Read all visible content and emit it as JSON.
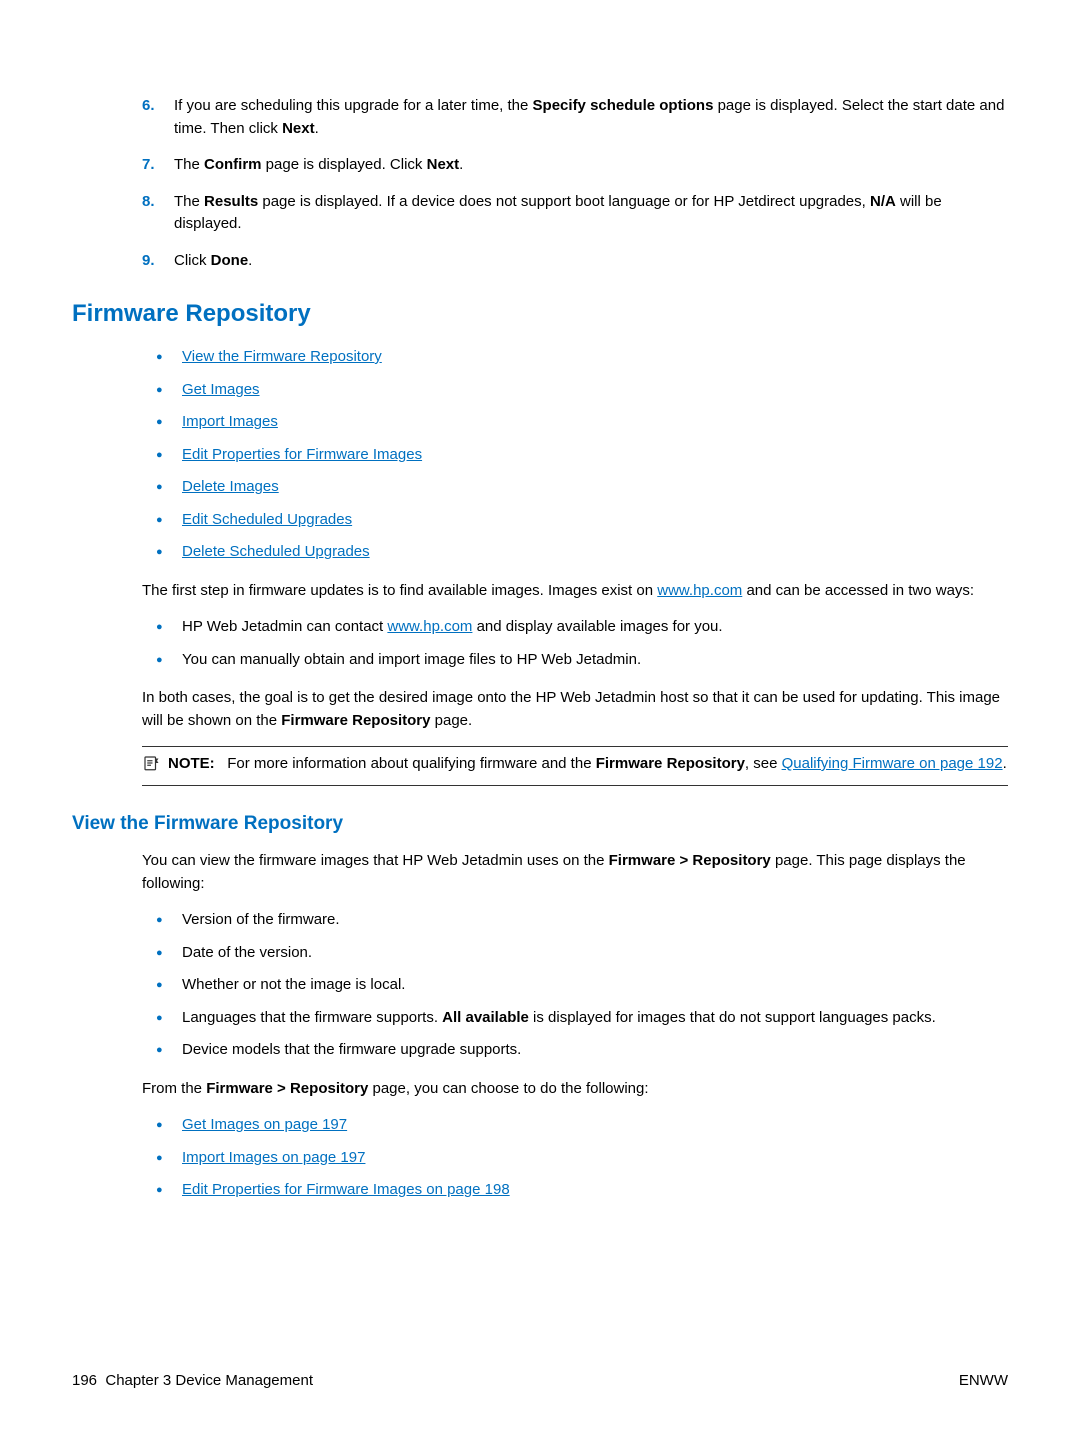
{
  "steps": [
    {
      "num": "6.",
      "pre": "If you are scheduling this upgrade for a later time, the ",
      "b1": "Specify schedule options",
      "mid": " page is displayed. Select the start date and time. Then click ",
      "b2": "Next",
      "post": "."
    },
    {
      "num": "7.",
      "pre": "The ",
      "b1": "Confirm",
      "mid": " page is displayed. Click ",
      "b2": "Next",
      "post": "."
    },
    {
      "num": "8.",
      "pre": "The ",
      "b1": "Results",
      "mid": " page is displayed. If a device does not support boot language or for HP Jetdirect upgrades, ",
      "b2": "N/A",
      "post": " will be displayed."
    },
    {
      "num": "9.",
      "pre": "Click ",
      "b1": "Done",
      "mid": "",
      "b2": "",
      "post": "."
    }
  ],
  "h1": "Firmware Repository",
  "links1": [
    "View the Firmware Repository",
    "Get Images",
    "Import Images",
    "Edit Properties for Firmware Images",
    "Delete Images",
    "Edit Scheduled Upgrades",
    "Delete Scheduled Upgrades"
  ],
  "p1": {
    "pre": "The first step in firmware updates is to find available images. Images exist on ",
    "link": "www.hp.com",
    "post": " and can be accessed in two ways:"
  },
  "ways": [
    {
      "pre": "HP Web Jetadmin can contact ",
      "link": "www.hp.com",
      "post": " and display available images for you."
    },
    {
      "pre": "You can manually obtain and import image files to HP Web Jetadmin.",
      "link": "",
      "post": ""
    }
  ],
  "p2": {
    "pre": "In both cases, the goal is to get the desired image onto the HP Web Jetadmin host so that it can be used for updating. This image will be shown on the ",
    "b": "Firmware Repository",
    "post": " page."
  },
  "note": {
    "label": "NOTE:",
    "pre": "For more information about qualifying firmware and the ",
    "b": "Firmware Repository",
    "mid": ", see ",
    "link": "Qualifying Firmware on page 192",
    "post": "."
  },
  "h2": "View the Firmware Repository",
  "p3": {
    "pre": "You can view the firmware images that HP Web Jetadmin uses on the ",
    "b": "Firmware > Repository",
    "post": " page. This page displays the following:"
  },
  "view_items": [
    {
      "pre": "Version of the firmware.",
      "b": "",
      "post": ""
    },
    {
      "pre": "Date of the version.",
      "b": "",
      "post": ""
    },
    {
      "pre": "Whether or not the image is local.",
      "b": "",
      "post": ""
    },
    {
      "pre": "Languages that the firmware supports. ",
      "b": "All available",
      "post": " is displayed for images that do not support languages packs."
    },
    {
      "pre": "Device models that the firmware upgrade supports.",
      "b": "",
      "post": ""
    }
  ],
  "p4": {
    "pre": "From the ",
    "b": "Firmware > Repository",
    "post": " page, you can choose to do the following:"
  },
  "links2": [
    "Get Images on page 197",
    "Import Images on page 197",
    "Edit Properties for Firmware Images on page 198"
  ],
  "footer": {
    "page": "196",
    "chapter": "Chapter 3   Device Management",
    "right": "ENWW"
  }
}
